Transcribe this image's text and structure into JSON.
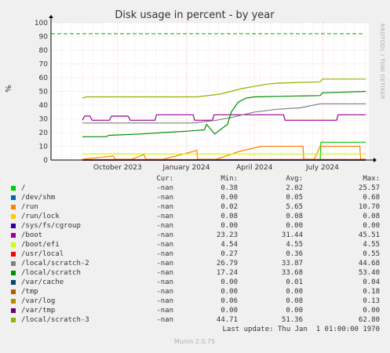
{
  "chart_data": {
    "type": "line",
    "title": "Disk usage in percent - by year",
    "ylabel": "%",
    "side_label": "RRDTOOL / TOBI OETIKER",
    "ylim": [
      0,
      100
    ],
    "yticks": [
      0,
      10,
      20,
      30,
      40,
      50,
      60,
      70,
      80,
      90,
      100
    ],
    "xlim": [
      "2023-07-04",
      "2024-09-01"
    ],
    "xticks": [
      {
        "label": "October 2023",
        "date": "2023-10-01"
      },
      {
        "label": "January 2024",
        "date": "2024-01-01"
      },
      {
        "label": "April 2024",
        "date": "2024-04-01"
      },
      {
        "label": "July 2024",
        "date": "2024-07-01"
      }
    ],
    "warning_line": {
      "value": 92,
      "color": "#00aa00",
      "style": "dashed"
    },
    "grid": true,
    "series": [
      {
        "name": "/",
        "color": "#00cc00",
        "points": [
          [
            "2024-06-28",
            0
          ],
          [
            "2024-06-29",
            13
          ],
          [
            "2024-08-28",
            13
          ]
        ]
      },
      {
        "name": "/dev/shm",
        "color": "#0066b3",
        "points": [
          [
            "2023-08-15",
            0
          ],
          [
            "2024-08-28",
            0
          ]
        ]
      },
      {
        "name": "/run",
        "color": "#ff8000",
        "points": [
          [
            "2023-08-15",
            0.5
          ],
          [
            "2023-09-25",
            3
          ],
          [
            "2023-09-28",
            0.5
          ],
          [
            "2023-10-20",
            0.5
          ],
          [
            "2023-11-05",
            4
          ],
          [
            "2023-11-08",
            0.5
          ],
          [
            "2023-12-01",
            0.5
          ],
          [
            "2024-01-15",
            7
          ],
          [
            "2024-01-16",
            0.5
          ],
          [
            "2024-02-10",
            0.5
          ],
          [
            "2024-03-10",
            6
          ],
          [
            "2024-04-10",
            10
          ],
          [
            "2024-06-05",
            10
          ],
          [
            "2024-06-06",
            0.5
          ],
          [
            "2024-06-20",
            0.5
          ],
          [
            "2024-06-28",
            10
          ],
          [
            "2024-08-20",
            10
          ],
          [
            "2024-08-21",
            0.5
          ],
          [
            "2024-08-28",
            0.5
          ]
        ]
      },
      {
        "name": "/run/lock",
        "color": "#ffcc00",
        "points": [
          [
            "2023-08-15",
            0
          ],
          [
            "2024-08-28",
            0
          ]
        ]
      },
      {
        "name": "/sys/fs/cgroup",
        "color": "#330099",
        "points": [
          [
            "2023-08-15",
            0
          ],
          [
            "2024-08-28",
            0
          ]
        ]
      },
      {
        "name": "/boot",
        "color": "#990099",
        "points": [
          [
            "2023-08-15",
            29
          ],
          [
            "2023-08-18",
            32
          ],
          [
            "2023-08-25",
            32
          ],
          [
            "2023-08-28",
            29
          ],
          [
            "2023-09-20",
            29
          ],
          [
            "2023-09-23",
            32
          ],
          [
            "2023-10-15",
            32
          ],
          [
            "2023-10-18",
            29
          ],
          [
            "2023-11-20",
            29
          ],
          [
            "2023-11-22",
            33
          ],
          [
            "2024-01-10",
            33
          ],
          [
            "2024-01-12",
            29
          ],
          [
            "2024-02-05",
            29
          ],
          [
            "2024-02-07",
            33
          ],
          [
            "2024-05-10",
            33
          ],
          [
            "2024-05-12",
            29
          ],
          [
            "2024-07-20",
            29
          ],
          [
            "2024-07-22",
            33
          ],
          [
            "2024-08-28",
            33
          ]
        ]
      },
      {
        "name": "/boot/efi",
        "color": "#ccff00",
        "points": [
          [
            "2023-08-15",
            4.5
          ],
          [
            "2024-08-28",
            4.5
          ]
        ]
      },
      {
        "name": "/usr/local",
        "color": "#ff0000",
        "points": [
          [
            "2023-08-15",
            0.3
          ],
          [
            "2024-08-28",
            0.4
          ]
        ]
      },
      {
        "name": "/local/scratch-2",
        "color": "#808080",
        "points": [
          [
            "2023-08-15",
            27
          ],
          [
            "2024-01-10",
            27
          ],
          [
            "2024-02-10",
            29
          ],
          [
            "2024-03-01",
            31
          ],
          [
            "2024-04-01",
            35
          ],
          [
            "2024-05-01",
            37
          ],
          [
            "2024-06-01",
            38
          ],
          [
            "2024-06-28",
            41
          ],
          [
            "2024-08-28",
            41
          ]
        ]
      },
      {
        "name": "/local/scratch",
        "color": "#008f00",
        "points": [
          [
            "2023-08-15",
            17
          ],
          [
            "2023-09-15",
            17
          ],
          [
            "2023-09-20",
            18
          ],
          [
            "2023-11-01",
            19
          ],
          [
            "2023-12-01",
            20
          ],
          [
            "2024-01-01",
            21
          ],
          [
            "2024-01-25",
            22
          ],
          [
            "2024-01-28",
            26
          ],
          [
            "2024-02-08",
            19
          ],
          [
            "2024-02-15",
            22
          ],
          [
            "2024-02-25",
            26
          ],
          [
            "2024-03-01",
            35
          ],
          [
            "2024-03-05",
            38
          ],
          [
            "2024-03-10",
            42
          ],
          [
            "2024-03-20",
            45
          ],
          [
            "2024-04-01",
            46
          ],
          [
            "2024-06-28",
            47
          ],
          [
            "2024-07-01",
            49
          ],
          [
            "2024-08-28",
            50
          ]
        ]
      },
      {
        "name": "/var/cache",
        "color": "#00487d",
        "points": [
          [
            "2023-08-15",
            0
          ],
          [
            "2024-08-28",
            0
          ]
        ]
      },
      {
        "name": "/tmp",
        "color": "#b35a00",
        "points": [
          [
            "2023-08-15",
            0
          ],
          [
            "2024-08-28",
            0.1
          ]
        ]
      },
      {
        "name": "/var/log",
        "color": "#b38f00",
        "points": [
          [
            "2023-08-15",
            0.05
          ],
          [
            "2024-08-28",
            0.1
          ]
        ]
      },
      {
        "name": "/var/tmp",
        "color": "#6b006b",
        "points": [
          [
            "2023-08-15",
            0
          ],
          [
            "2024-08-28",
            0
          ]
        ]
      },
      {
        "name": "/local/scratch-3",
        "color": "#8fb300",
        "points": [
          [
            "2023-08-15",
            45
          ],
          [
            "2023-08-20",
            46
          ],
          [
            "2024-01-15",
            46
          ],
          [
            "2024-02-15",
            48
          ],
          [
            "2024-03-15",
            52
          ],
          [
            "2024-04-15",
            55
          ],
          [
            "2024-05-01",
            56
          ],
          [
            "2024-06-28",
            57
          ],
          [
            "2024-07-01",
            59
          ],
          [
            "2024-08-28",
            59
          ]
        ]
      }
    ]
  },
  "legend": {
    "headers": {
      "cur": "Cur:",
      "min": "Min:",
      "avg": "Avg:",
      "max": "Max:"
    },
    "rows": [
      {
        "name": "/",
        "color": "#00cc00",
        "cur": "-nan",
        "min": "0.38",
        "avg": "2.02",
        "max": "25.57"
      },
      {
        "name": "/dev/shm",
        "color": "#0066b3",
        "cur": "-nan",
        "min": "0.00",
        "avg": "0.05",
        "max": "0.68"
      },
      {
        "name": "/run",
        "color": "#ff8000",
        "cur": "-nan",
        "min": "0.02",
        "avg": "5.65",
        "max": "10.70"
      },
      {
        "name": "/run/lock",
        "color": "#ffcc00",
        "cur": "-nan",
        "min": "0.08",
        "avg": "0.08",
        "max": "0.08"
      },
      {
        "name": "/sys/fs/cgroup",
        "color": "#330099",
        "cur": "-nan",
        "min": "0.00",
        "avg": "0.00",
        "max": "0.00"
      },
      {
        "name": "/boot",
        "color": "#990099",
        "cur": "-nan",
        "min": "23.23",
        "avg": "31.44",
        "max": "45.51"
      },
      {
        "name": "/boot/efi",
        "color": "#ccff00",
        "cur": "-nan",
        "min": "4.54",
        "avg": "4.55",
        "max": "4.55"
      },
      {
        "name": "/usr/local",
        "color": "#ff0000",
        "cur": "-nan",
        "min": "0.27",
        "avg": "0.36",
        "max": "0.55"
      },
      {
        "name": "/local/scratch-2",
        "color": "#808080",
        "cur": "-nan",
        "min": "26.79",
        "avg": "33.87",
        "max": "44.68"
      },
      {
        "name": "/local/scratch",
        "color": "#008f00",
        "cur": "-nan",
        "min": "17.24",
        "avg": "33.68",
        "max": "53.40"
      },
      {
        "name": "/var/cache",
        "color": "#00487d",
        "cur": "-nan",
        "min": "0.00",
        "avg": "0.01",
        "max": "0.04"
      },
      {
        "name": "/tmp",
        "color": "#b35a00",
        "cur": "-nan",
        "min": "0.00",
        "avg": "0.00",
        "max": "0.18"
      },
      {
        "name": "/var/log",
        "color": "#b38f00",
        "cur": "-nan",
        "min": "0.06",
        "avg": "0.08",
        "max": "0.13"
      },
      {
        "name": "/var/tmp",
        "color": "#6b006b",
        "cur": "-nan",
        "min": "0.00",
        "avg": "0.00",
        "max": "0.00"
      },
      {
        "name": "/local/scratch-3",
        "color": "#8fb300",
        "cur": "-nan",
        "min": "44.71",
        "avg": "51.36",
        "max": "62.80"
      }
    ],
    "last_update": "Last update: Thu Jan  1 01:00:00 1970"
  },
  "footer": "Munin 2.0.75"
}
